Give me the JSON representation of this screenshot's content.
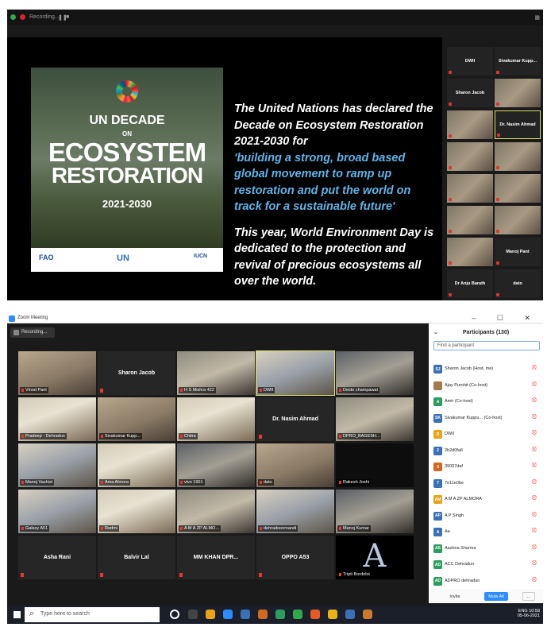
{
  "top": {
    "recording_label": "Recording...",
    "slide": {
      "poster": {
        "line1": "UN DECADE",
        "line2": "ON",
        "line3": "ECOSYSTEM",
        "line4": "RESTORATION",
        "years": "2021-2030",
        "logos": [
          "FAO",
          "UN",
          "IUCN"
        ]
      },
      "quote": {
        "p1": "The United Nations has declared the Decade on Ecosystem Restoration 2021-2030 for",
        "p1_highlight": "'building a strong, broad based global movement to ramp up restoration and put the world on track for a sustainable future'",
        "p2": "This year, World Environment Day is dedicated to the protection and revival of precious ecosystems all over the world."
      }
    },
    "side_tiles": [
      {
        "name": "DWII"
      },
      {
        "name": "Sivakumar Kupp..."
      },
      {
        "name": "Sharon Jacob"
      },
      {
        "name": ""
      },
      {
        "name": ""
      },
      {
        "name": "Dr. Nasim Ahmad"
      },
      {
        "name": ""
      },
      {
        "name": ""
      },
      {
        "name": ""
      },
      {
        "name": ""
      },
      {
        "name": ""
      },
      {
        "name": ""
      },
      {
        "name": ""
      },
      {
        "name": "Manoj Pant"
      },
      {
        "name": "Dr Anju Barath"
      },
      {
        "name": "dato"
      }
    ]
  },
  "window": {
    "title": "Zoom Meeting",
    "controls": "– ☐ ✕",
    "recording": "Recording...",
    "tiles": [
      {
        "label": "Vinod Pant",
        "name": ""
      },
      {
        "label": "",
        "name": "Sharon Jacob"
      },
      {
        "label": "H S Mishra 422",
        "name": ""
      },
      {
        "label": "DWII",
        "name": ""
      },
      {
        "label": "Desto champawat",
        "name": ""
      },
      {
        "label": "Pradeep - Dehradun",
        "name": ""
      },
      {
        "label": "Sivakumar Kupp...",
        "name": ""
      },
      {
        "label": "Chitra",
        "name": ""
      },
      {
        "label": "",
        "name": "Dr. Nasim Ahmad"
      },
      {
        "label": "DPRO_BAGESH...",
        "name": ""
      },
      {
        "label": "Manoj Vashist",
        "name": ""
      },
      {
        "label": "Ama Almora",
        "name": ""
      },
      {
        "label": "vivo 1901",
        "name": ""
      },
      {
        "label": "dato",
        "name": ""
      },
      {
        "label": "Rakesh Joshi",
        "name": ""
      },
      {
        "label": "Galaxy A51",
        "name": ""
      },
      {
        "label": "Redmi",
        "name": ""
      },
      {
        "label": "A M A ZP ALMO...",
        "name": ""
      },
      {
        "label": "dehradoonmandi",
        "name": ""
      },
      {
        "label": "Manoj Kumar",
        "name": ""
      },
      {
        "label": "",
        "name": "Asha Rani"
      },
      {
        "label": "",
        "name": "Balvir Lal"
      },
      {
        "label": "",
        "name": "MM KHAN DPR..."
      },
      {
        "label": "",
        "name": "OPPO A53"
      },
      {
        "label": "Tripti Bordoloi",
        "name": ""
      }
    ],
    "participants": {
      "header": "Participants (130)",
      "search_placeholder": "Find a participant",
      "list": [
        {
          "initials": "SJ",
          "color": "#3b6fb6",
          "name": "Sharon Jacob (Host, me)"
        },
        {
          "initials": "",
          "color": "#a37a4e",
          "name": "Ajay Purohit (Co-host)"
        },
        {
          "initials": "A",
          "color": "#2a9d5f",
          "name": "Amir (Co-host)"
        },
        {
          "initials": "SK",
          "color": "#3b6fb6",
          "name": "Sivakumar Kuppu... (Co-host)"
        },
        {
          "initials": "D",
          "color": "#e8a317",
          "name": "DWII"
        },
        {
          "initials": "2",
          "color": "#3b6fb6",
          "name": "2b2d0fa6"
        },
        {
          "initials": "3",
          "color": "#d2691e",
          "name": "39007daf"
        },
        {
          "initials": "7",
          "color": "#3b6fb6",
          "name": "7e11e0be"
        },
        {
          "initials": "AM",
          "color": "#e8a317",
          "name": "A M A ZP ALMORA"
        },
        {
          "initials": "AP",
          "color": "#3b6fb6",
          "name": "A P Singh"
        },
        {
          "initials": "A",
          "color": "#3b6fb6",
          "name": "Aa"
        },
        {
          "initials": "AS",
          "color": "#2a9d5f",
          "name": "Aashna Sharma"
        },
        {
          "initials": "AD",
          "color": "#2a9d5f",
          "name": "ACC Dehradun"
        },
        {
          "initials": "AD",
          "color": "#2a9d5f",
          "name": "ADPRO dehradun"
        }
      ],
      "invite": "Invite",
      "mute_all": "Mute All",
      "more": "..."
    },
    "taskbar": {
      "search": "Type here to search",
      "time": "10:58",
      "date": "05-06-2021",
      "lang": "ENG"
    }
  }
}
